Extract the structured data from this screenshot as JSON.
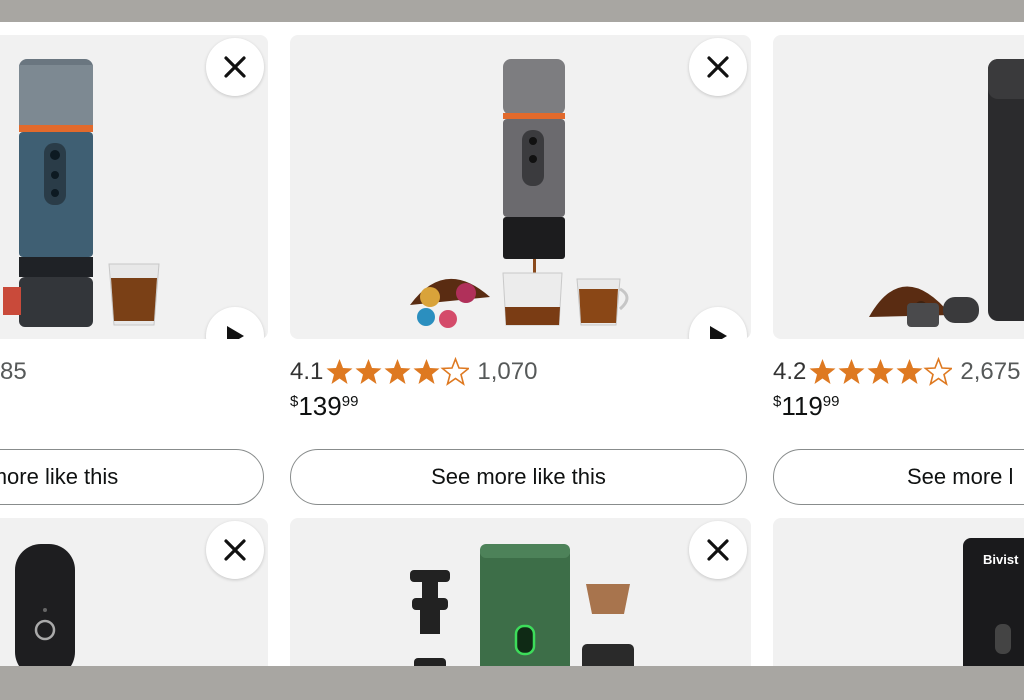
{
  "cards": [
    {
      "rating": "",
      "count": "85",
      "price_dollars": "",
      "price_cents": "",
      "cta": "more like this",
      "close_icon": "close-icon",
      "play_icon": "play-icon"
    },
    {
      "rating": "4.1",
      "stars": 4.1,
      "count": "1,070",
      "price_currency": "$",
      "price_dollars": "139",
      "price_cents": "99",
      "cta": "See more like this",
      "close_icon": "close-icon",
      "play_icon": "play-icon"
    },
    {
      "rating": "4.2",
      "stars": 4.2,
      "count": "2,675",
      "price_currency": "$",
      "price_dollars": "119",
      "price_cents": "99",
      "cta": "See more l",
      "close_icon": "close-icon"
    }
  ],
  "bottom_row": [
    {
      "close_icon": "close-icon"
    },
    {
      "close_icon": "close-icon"
    },
    {
      "brand_text": "Bivist"
    }
  ],
  "colors": {
    "star": "#de7921",
    "accent_orange": "#e36a2a",
    "frame": "#a8a6a2"
  }
}
